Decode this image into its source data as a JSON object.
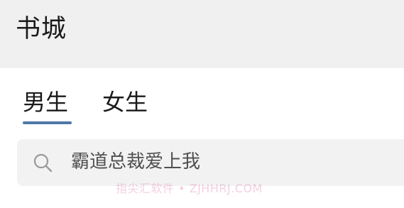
{
  "header": {
    "title": "书城"
  },
  "tabs": [
    {
      "label": "男生",
      "selected": true
    },
    {
      "label": "女生",
      "selected": false
    }
  ],
  "search": {
    "icon": "search-icon",
    "placeholder": "霸道总裁爱上我"
  },
  "watermark": "指尖汇软件 • ZJHHRJ.COM",
  "colors": {
    "header_bg": "#f0f0f0",
    "tab_indicator": "#4f78a8",
    "search_bg": "#f2f2f2"
  }
}
